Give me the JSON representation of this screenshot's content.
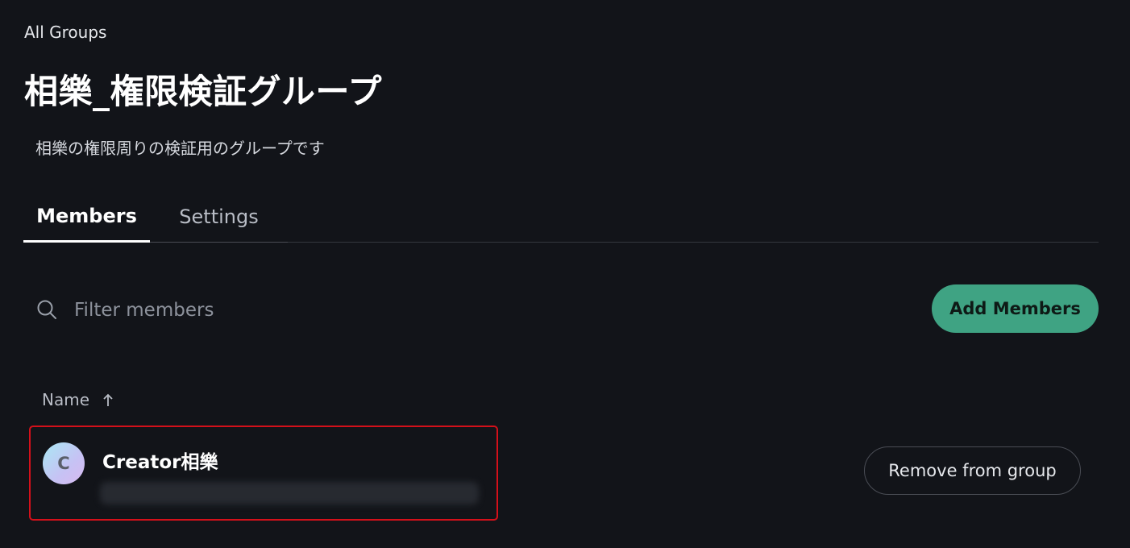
{
  "breadcrumb": {
    "label": "All Groups"
  },
  "group": {
    "title": "相樂_権限検証グループ",
    "description": "相樂の権限周りの検証用のグループです"
  },
  "tabs": [
    {
      "label": "Members",
      "active": true
    },
    {
      "label": "Settings",
      "active": false
    }
  ],
  "search": {
    "placeholder": "Filter members",
    "value": "",
    "icon": "search-icon"
  },
  "actions": {
    "add_members_label": "Add Members"
  },
  "table": {
    "columns": [
      {
        "label": "Name",
        "sort": "ascending",
        "sort_icon": "arrow-up-icon"
      }
    ],
    "rows": [
      {
        "avatar_initial": "C",
        "name": "Creator相樂",
        "email": "",
        "remove_label": "Remove from group"
      }
    ]
  },
  "colors": {
    "background": "#121419",
    "accent": "#3fa383",
    "highlight_border": "#d4101a"
  }
}
